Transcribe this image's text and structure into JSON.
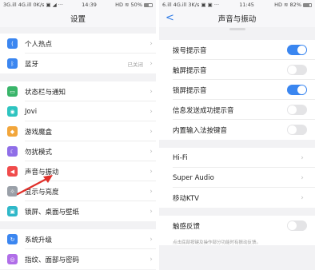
{
  "left": {
    "status": {
      "left": "3G.ill 4G.ill 0K/s ▣ ◢ ···",
      "time": "14:39",
      "right": "HD ≋ 50%"
    },
    "title": "设置",
    "groups": [
      [
        {
          "label": "个人热点",
          "icon": "hotspot-icon",
          "color": "#3b86f0"
        },
        {
          "label": "蓝牙",
          "icon": "bluetooth-icon",
          "color": "#3b86f0",
          "value": "已关闭"
        }
      ],
      [
        {
          "label": "状态栏与通知",
          "icon": "notification-icon",
          "color": "#39b56a"
        },
        {
          "label": "Jovi",
          "icon": "jovi-icon",
          "color": "#2ec4c0"
        },
        {
          "label": "游戏魔盒",
          "icon": "game-box-icon",
          "color": "#f2a63b"
        },
        {
          "label": "勿扰模式",
          "icon": "do-not-disturb-icon",
          "color": "#8f6ee8"
        },
        {
          "label": "声音与振动",
          "icon": "sound-icon",
          "color": "#f04b4b"
        },
        {
          "label": "显示与亮度",
          "icon": "brightness-icon",
          "color": "#9aa0a8"
        },
        {
          "label": "锁屏、桌面与壁纸",
          "icon": "wallpaper-icon",
          "color": "#2fb8c9"
        }
      ],
      [
        {
          "label": "系统升级",
          "icon": "system-update-icon",
          "color": "#3b86f0"
        },
        {
          "label": "指纹、面部与密码",
          "icon": "fingerprint-icon",
          "color": "#b06ee8"
        }
      ]
    ]
  },
  "right": {
    "status": {
      "left": "6.ill 4G.ill 3K/s ▣ ▣ ···",
      "time": "11:45",
      "right": "HD ≋ 82%"
    },
    "title": "声音与振动",
    "toggles": [
      {
        "label": "拨号提示音",
        "on": true
      },
      {
        "label": "触屏提示音",
        "on": false
      },
      {
        "label": "锁屏提示音",
        "on": true
      },
      {
        "label": "信息发送成功提示音",
        "on": false
      },
      {
        "label": "内置输入法按键音",
        "on": false
      }
    ],
    "links": [
      {
        "label": "Hi-Fi"
      },
      {
        "label": "Super Audio"
      },
      {
        "label": "移动KTV"
      }
    ],
    "haptic": {
      "label": "触感反馈",
      "on": false
    },
    "note": "点击底部按键及操作部分功能时有振动反馈。"
  }
}
